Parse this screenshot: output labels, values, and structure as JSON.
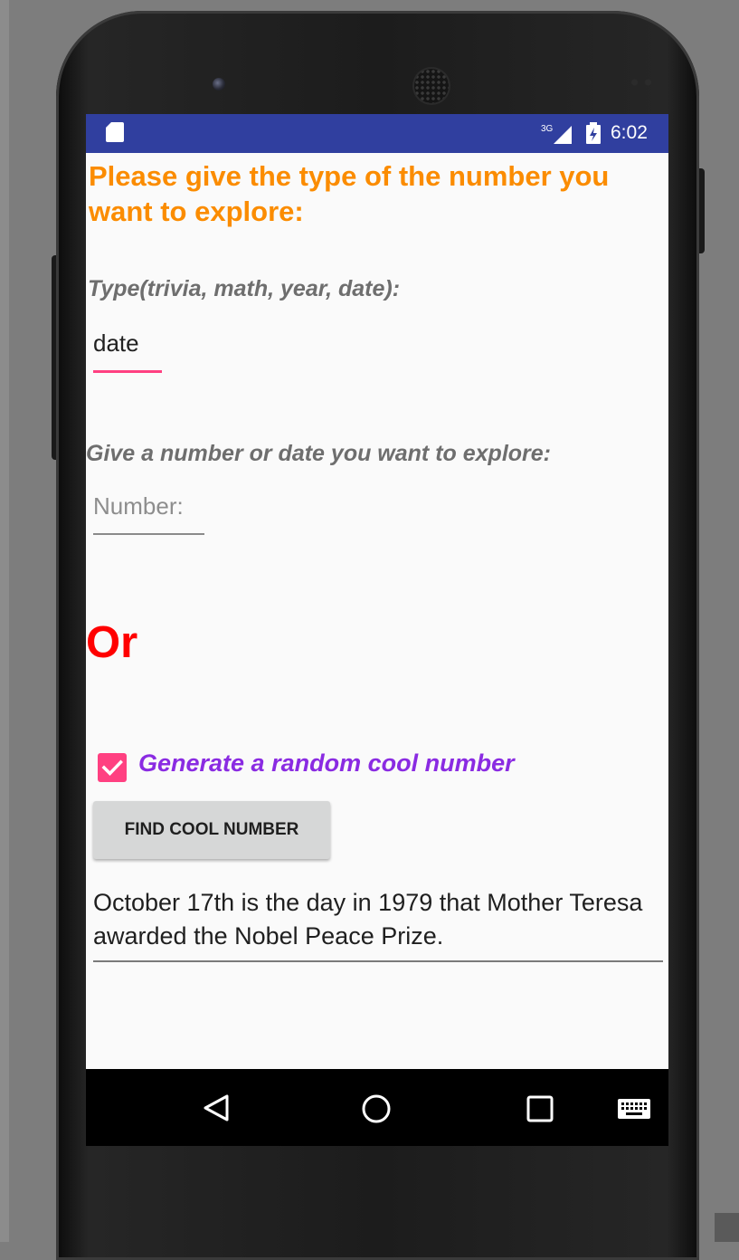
{
  "status_bar": {
    "time": "6:02",
    "network": "3G",
    "icons": [
      "sd-card-icon",
      "signal-icon",
      "battery-icon"
    ],
    "color": "#303f9f"
  },
  "form": {
    "heading": "Please give the type of the number you want to explore:",
    "type_label": "Type(trivia, math, year, date):",
    "type_value": "date",
    "number_label": "Give a number or date you want to explore:",
    "number_placeholder": "Number:",
    "or_text": "Or",
    "random_checkbox_label": "Generate a random cool number",
    "random_checkbox_checked": true,
    "find_button_label": "FIND COOL NUMBER",
    "result_text": "October 17th is the day in 1979 that Mother Teresa awarded the Nobel Peace Prize."
  },
  "nav_bar": {
    "buttons": [
      "back-icon",
      "home-icon",
      "recents-icon",
      "keyboard-icon"
    ]
  },
  "colors": {
    "heading": "#fb8c00",
    "or": "#ff0000",
    "checkbox_label": "#8a2be2",
    "accent": "#ff4081"
  }
}
